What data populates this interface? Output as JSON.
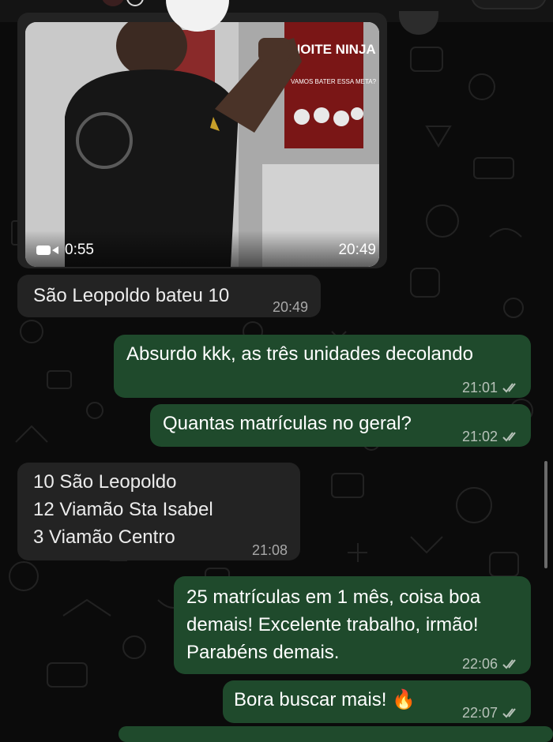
{
  "video_message": {
    "duration": "0:55",
    "time": "20:49",
    "poster_title": "NOITE NINJA",
    "poster_subtitle": "VAMOS BATER ESSA META?"
  },
  "messages": [
    {
      "direction": "in",
      "lines": [
        "São Leopoldo bateu 10"
      ],
      "time": "20:49"
    },
    {
      "direction": "out",
      "lines": [
        "Absurdo kkk, as três unidades decolando"
      ],
      "time": "21:01",
      "status": "read"
    },
    {
      "direction": "out",
      "lines": [
        "Quantas matrículas no geral?"
      ],
      "time": "21:02",
      "status": "read"
    },
    {
      "direction": "in",
      "lines": [
        "10 São Leopoldo",
        "12 Viamão Sta Isabel",
        "3 Viamão Centro"
      ],
      "time": "21:08"
    },
    {
      "direction": "out",
      "lines": [
        "25 matrículas em 1 mês, coisa boa",
        "demais! Excelente trabalho, irmão!",
        "Parabéns demais."
      ],
      "time": "22:06",
      "status": "read"
    },
    {
      "direction": "out",
      "lines": [
        "Bora buscar mais! 🔥"
      ],
      "time": "22:07",
      "status": "read"
    }
  ],
  "colors": {
    "background": "#0b0b0b",
    "incoming_bubble": "#232323",
    "outgoing_bubble": "#1f4a2c"
  }
}
